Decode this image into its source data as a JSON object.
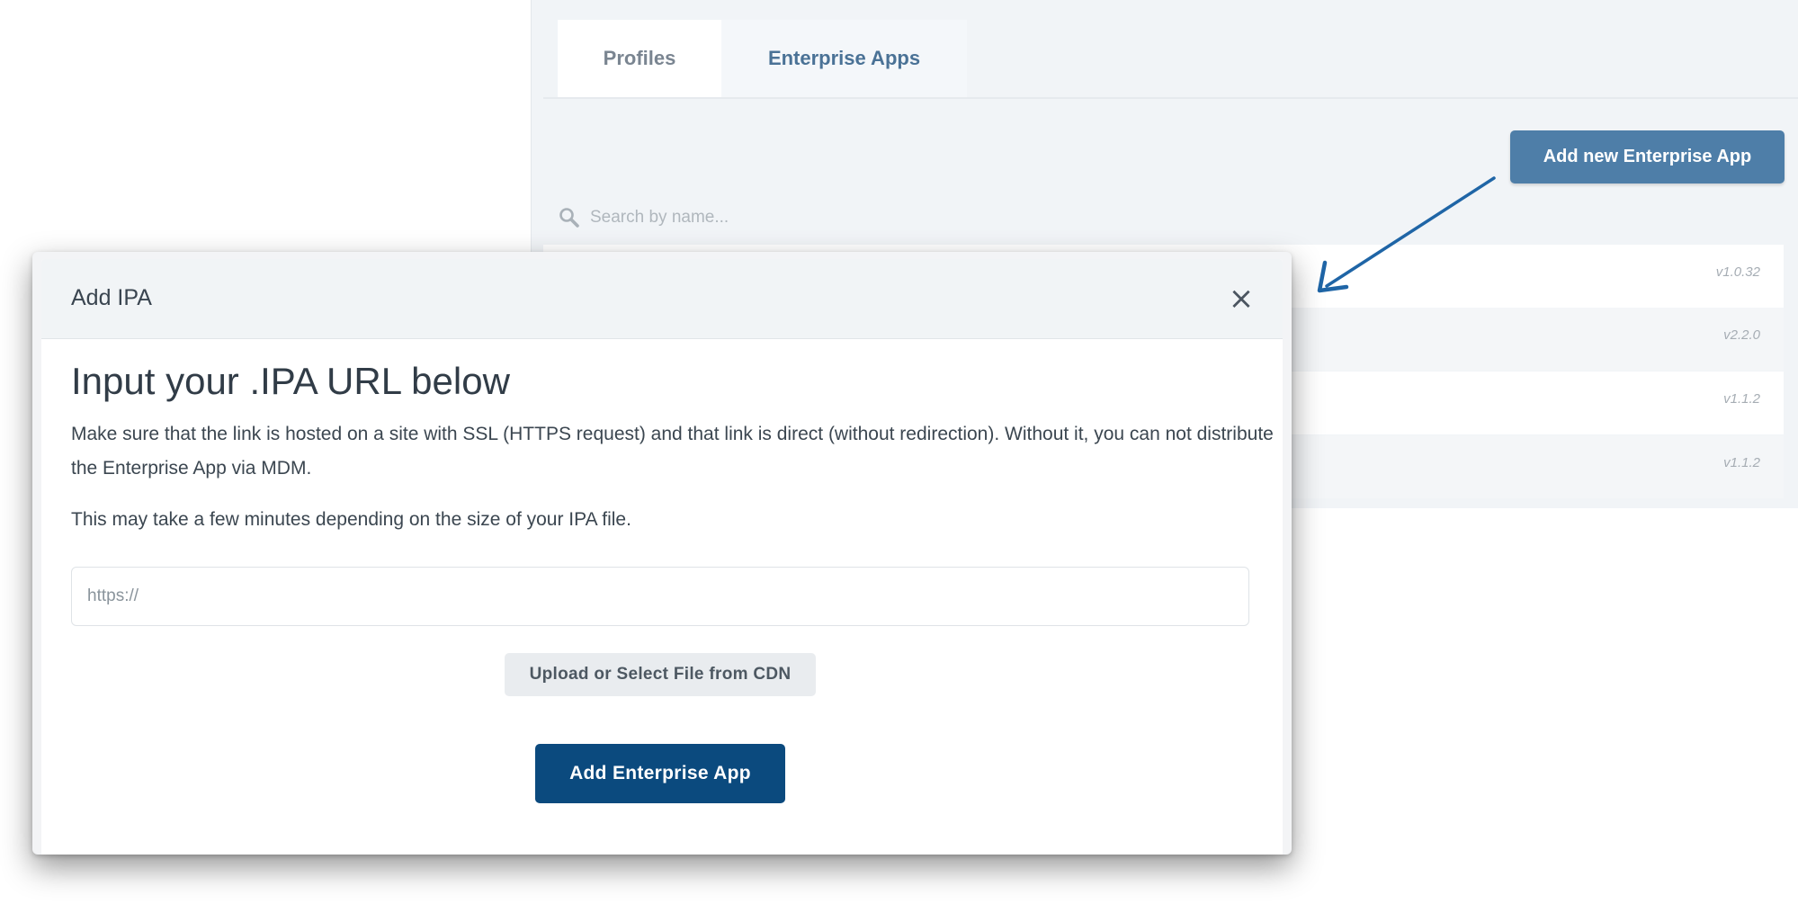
{
  "tabs": [
    {
      "label": "Profiles"
    },
    {
      "label": "Enterprise Apps",
      "active": true
    }
  ],
  "toolbar": {
    "add_new_label": "Add new Enterprise App"
  },
  "search": {
    "placeholder": "Search by name..."
  },
  "apps": [
    {
      "version": "v1.0.32"
    },
    {
      "version": "v2.2.0"
    },
    {
      "version": "v1.1.2"
    },
    {
      "version": "v1.1.2"
    }
  ],
  "modal": {
    "title": "Add IPA",
    "heading": "Input your .IPA URL below",
    "description": "Make sure that the link is hosted on a site with SSL (HTTPS request) and that link is direct (without redirection). Without it, you can not distribute the Enterprise App via MDM.",
    "note": "This may take a few minutes depending on the size of your IPA file.",
    "url_placeholder": "https://",
    "upload_label": "Upload or Select File from CDN",
    "submit_label": "Add Enterprise App",
    "close_icon": "×"
  },
  "colors": {
    "primary": "#0b4a7e",
    "secondary_button": "#4e7ea8",
    "arrow": "#1f65a6",
    "active_tab_text": "#4a7296"
  },
  "icons": {
    "search": "search-icon",
    "close": "close-icon",
    "arrow": "arrow-annotation"
  }
}
